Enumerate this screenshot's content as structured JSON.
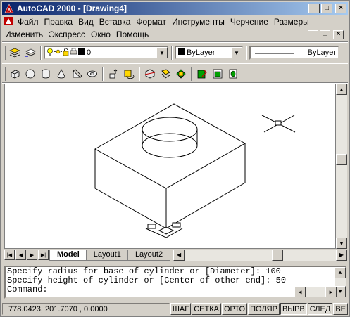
{
  "window": {
    "title": "AutoCAD 2000 - [Drawing4]",
    "minimize": "_",
    "maximize": "□",
    "close": "×"
  },
  "menu": {
    "row1": [
      "Файл",
      "Правка",
      "Вид",
      "Вставка",
      "Формат",
      "Инструменты",
      "Черчение",
      "Размеры"
    ],
    "row2": [
      "Изменить",
      "Экспресс",
      "Окно",
      "Помощь"
    ]
  },
  "layers": {
    "current_layer": "0",
    "color": "ByLayer",
    "linetype": "ByLayer"
  },
  "command": {
    "line1": "Specify radius for base of cylinder or [Diameter]: 100",
    "line2": "Specify height of cylinder or [Center of other end]: 50",
    "prompt": "Command:"
  },
  "tabs": [
    "Model",
    "Layout1",
    "Layout2"
  ],
  "status": {
    "coords": "778.0423, 201.7070 , 0.0000",
    "toggles": [
      "ШАГ",
      "СЕТКА",
      "ОРТО",
      "ПОЛЯР",
      "ВЫРВ",
      "СЛЕД",
      "ВЕ"
    ]
  },
  "colors": {
    "title_start": "#0a246a",
    "title_end": "#a6caf0",
    "face": "#d4d0c8"
  }
}
